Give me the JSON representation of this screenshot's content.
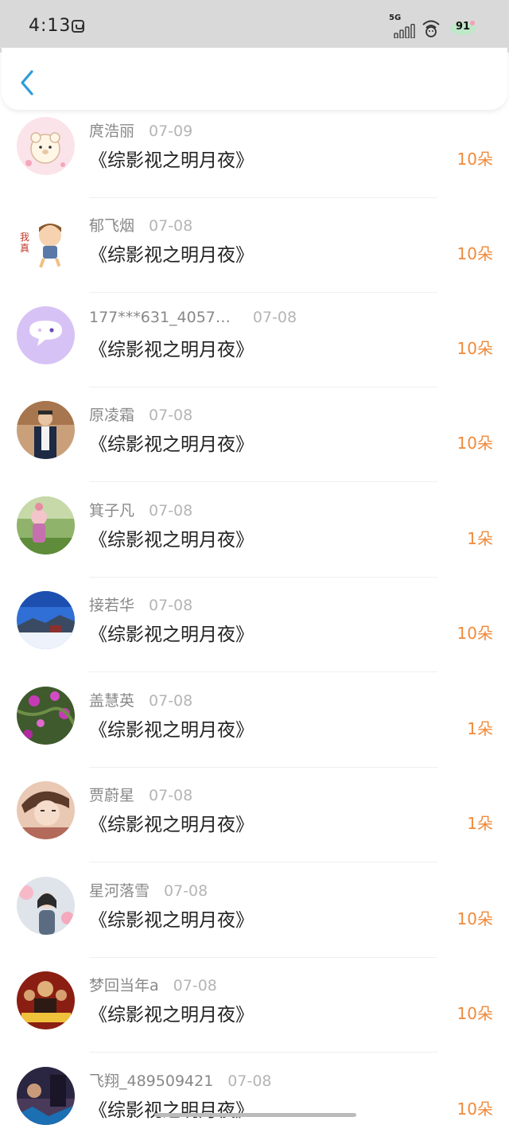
{
  "status_bar": {
    "time": "4:13",
    "network": "5G",
    "battery": "91"
  },
  "entries": [
    {
      "name": "庹浩丽",
      "date": "07-09",
      "title": "《综影视之明月夜》",
      "count": "10朵",
      "avatar": "bear-icon"
    },
    {
      "name": "郁飞烟",
      "date": "07-08",
      "title": "《综影视之明月夜》",
      "count": "10朵",
      "avatar": "cartoon-boy-icon"
    },
    {
      "name": "177***631_4057…",
      "date": "07-08",
      "title": "《综影视之明月夜》",
      "count": "10朵",
      "avatar": "chat-bubble-icon"
    },
    {
      "name": "原凌霜",
      "date": "07-08",
      "title": "《综影视之明月夜》",
      "count": "10朵",
      "avatar": "person-photo-icon"
    },
    {
      "name": "箕子凡",
      "date": "07-08",
      "title": "《综影视之明月夜》",
      "count": "1朵",
      "avatar": "doll-photo-icon"
    },
    {
      "name": "接若华",
      "date": "07-08",
      "title": "《综影视之明月夜》",
      "count": "10朵",
      "avatar": "snow-landscape-icon"
    },
    {
      "name": "盖慧英",
      "date": "07-08",
      "title": "《综影视之明月夜》",
      "count": "1朵",
      "avatar": "flower-photo-icon"
    },
    {
      "name": "贾蔚星",
      "date": "07-08",
      "title": "《综影视之明月夜》",
      "count": "1朵",
      "avatar": "anime-boy-icon"
    },
    {
      "name": "星河落雪",
      "date": "07-08",
      "title": "《综影视之明月夜》",
      "count": "10朵",
      "avatar": "girl-photo-icon"
    },
    {
      "name": "梦回当年a",
      "date": "07-08",
      "title": "《综影视之明月夜》",
      "count": "10朵",
      "avatar": "movie-poster-icon"
    },
    {
      "name": "飞翔_489509421",
      "date": "07-08",
      "title": "《综影视之明月夜》",
      "count": "10朵",
      "avatar": "dark-poster-icon"
    }
  ],
  "colors": {
    "accent": "#f08a3a",
    "back_arrow": "#2d9cdb",
    "status_bar": "#d9d9d9"
  }
}
